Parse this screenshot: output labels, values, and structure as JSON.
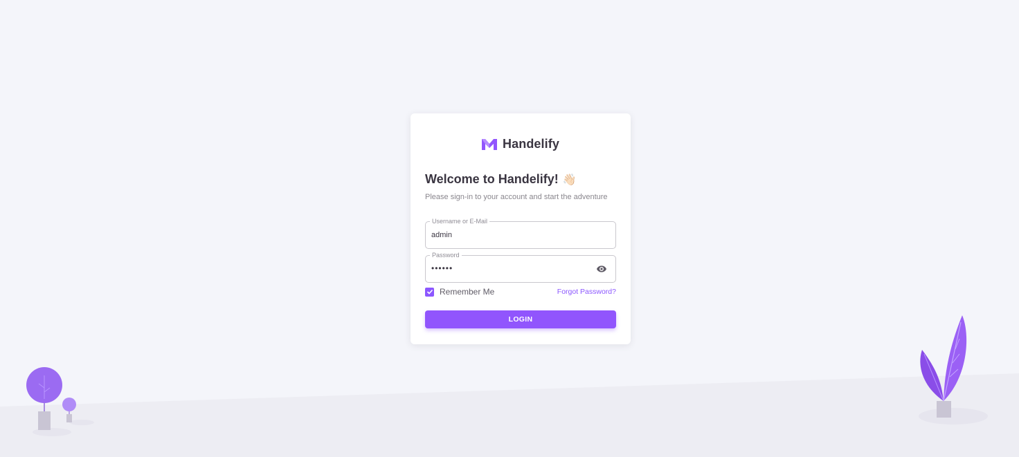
{
  "brand": {
    "name": "Handelify",
    "logo_icon": "handelify-logo-icon",
    "accent": "#9155fd"
  },
  "welcome": {
    "title": "Welcome to Handelify!",
    "emoji": "👋🏻",
    "subtitle": "Please sign-in to your account and start the adventure"
  },
  "form": {
    "username": {
      "label": "Username or E-Mail",
      "value": "admin"
    },
    "password": {
      "label": "Password",
      "value": "••••••",
      "toggle_icon": "eye-icon"
    },
    "remember": {
      "label": "Remember Me",
      "checked": true
    },
    "forgot_label": "Forgot Password?",
    "login_label": "LOGIN"
  },
  "illustrations": {
    "left": "tree-illustration",
    "right": "leaf-plant-illustration"
  }
}
